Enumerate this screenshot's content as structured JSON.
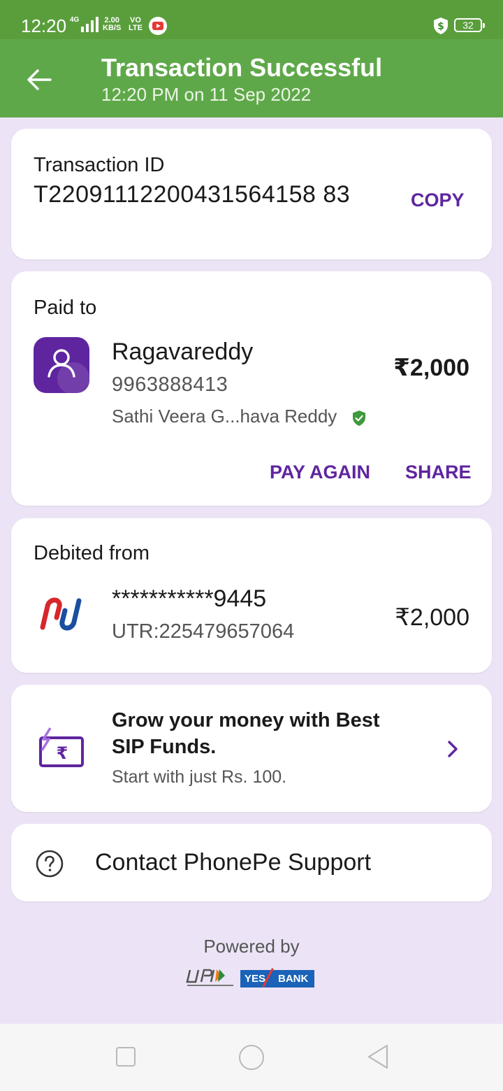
{
  "status_bar": {
    "time": "12:20",
    "network": "4G",
    "speed_value": "2.00",
    "speed_unit": "KB/S",
    "volte_top": "VO",
    "volte_bottom": "LTE",
    "battery": "32"
  },
  "header": {
    "title": "Transaction Successful",
    "subtitle": "12:20 PM on 11 Sep 2022"
  },
  "transaction": {
    "label": "Transaction ID",
    "id": "T22091112200431564158 83",
    "copy_label": "COPY"
  },
  "paid_to": {
    "label": "Paid to",
    "name": "Ragavareddy",
    "phone": "9963888413",
    "full_name": "Sathi  Veera G...hava Reddy",
    "amount": "₹2,000",
    "pay_again_label": "PAY AGAIN",
    "share_label": "SHARE"
  },
  "debited_from": {
    "label": "Debited from",
    "account": "***********9445",
    "utr": "UTR:225479657064",
    "amount": "₹2,000"
  },
  "promo": {
    "title": "Grow your money with Best SIP Funds.",
    "subtitle": "Start with just Rs. 100."
  },
  "support": {
    "label": "Contact PhonePe Support"
  },
  "footer": {
    "powered_by": "Powered by",
    "yes": "YES",
    "bank": "BANK"
  },
  "colors": {
    "header_green": "#5fa84a",
    "accent_purple": "#5f259f",
    "background": "#ece4f6"
  }
}
